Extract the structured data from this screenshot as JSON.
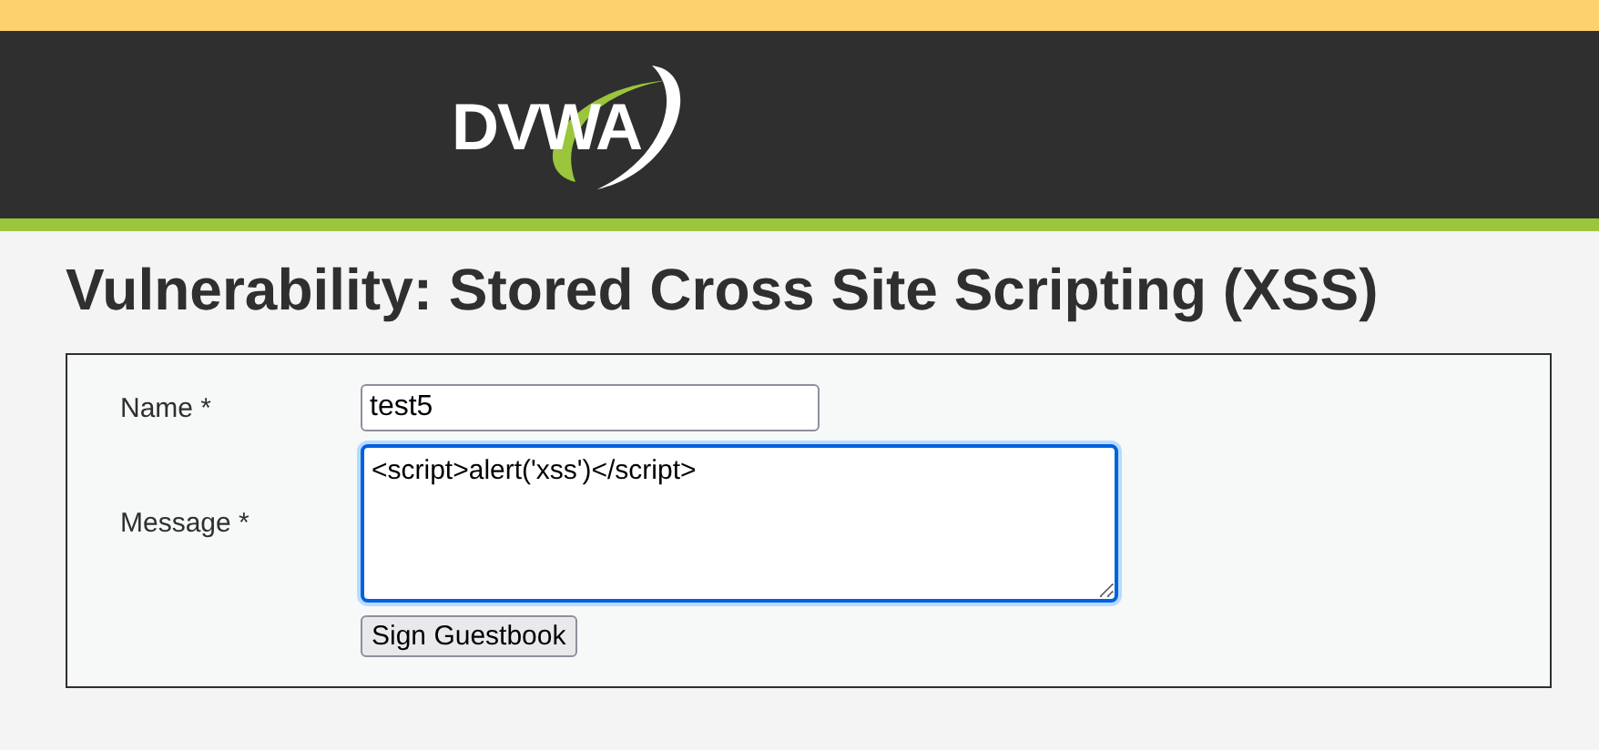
{
  "header": {
    "logo": "DVWA"
  },
  "title": "Vulnerability: Stored Cross Site Scripting (XSS)",
  "form": {
    "fields": [
      {
        "kind": "input",
        "label": "Name *",
        "value": "test5",
        "focused": false
      },
      {
        "kind": "textarea",
        "label": "Message *",
        "value": "<script>alert('xss')</script>",
        "focused": true
      }
    ],
    "button": "Sign Guestbook"
  }
}
